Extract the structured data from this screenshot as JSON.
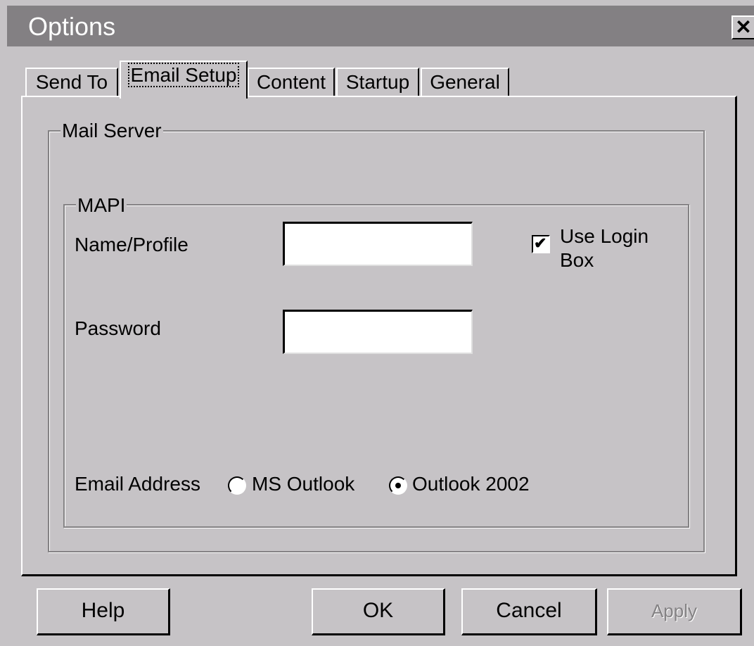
{
  "window": {
    "title": "Options",
    "close_glyph": "✕"
  },
  "tabs": [
    {
      "label": "Send To",
      "active": false
    },
    {
      "label": "Email Setup",
      "active": true
    },
    {
      "label": "Content",
      "active": false
    },
    {
      "label": "Startup",
      "active": false
    },
    {
      "label": "General",
      "active": false
    }
  ],
  "mail_server": {
    "legend": "Mail Server",
    "mapi": {
      "legend": "MAPI",
      "name_profile_label": "Name/Profile",
      "name_profile_value": "",
      "password_label": "Password",
      "password_value": "",
      "use_login_box_line1": "Use Login",
      "use_login_box_line2": "Box",
      "use_login_box_checked": true,
      "check_glyph": "✔",
      "email_address_label": "Email Address",
      "radio_ms_outlook": "MS Outlook",
      "radio_outlook_2002": "Outlook 2002",
      "selected_radio": "Outlook 2002"
    }
  },
  "buttons": {
    "help": "Help",
    "ok": "OK",
    "cancel": "Cancel",
    "apply": "Apply"
  }
}
